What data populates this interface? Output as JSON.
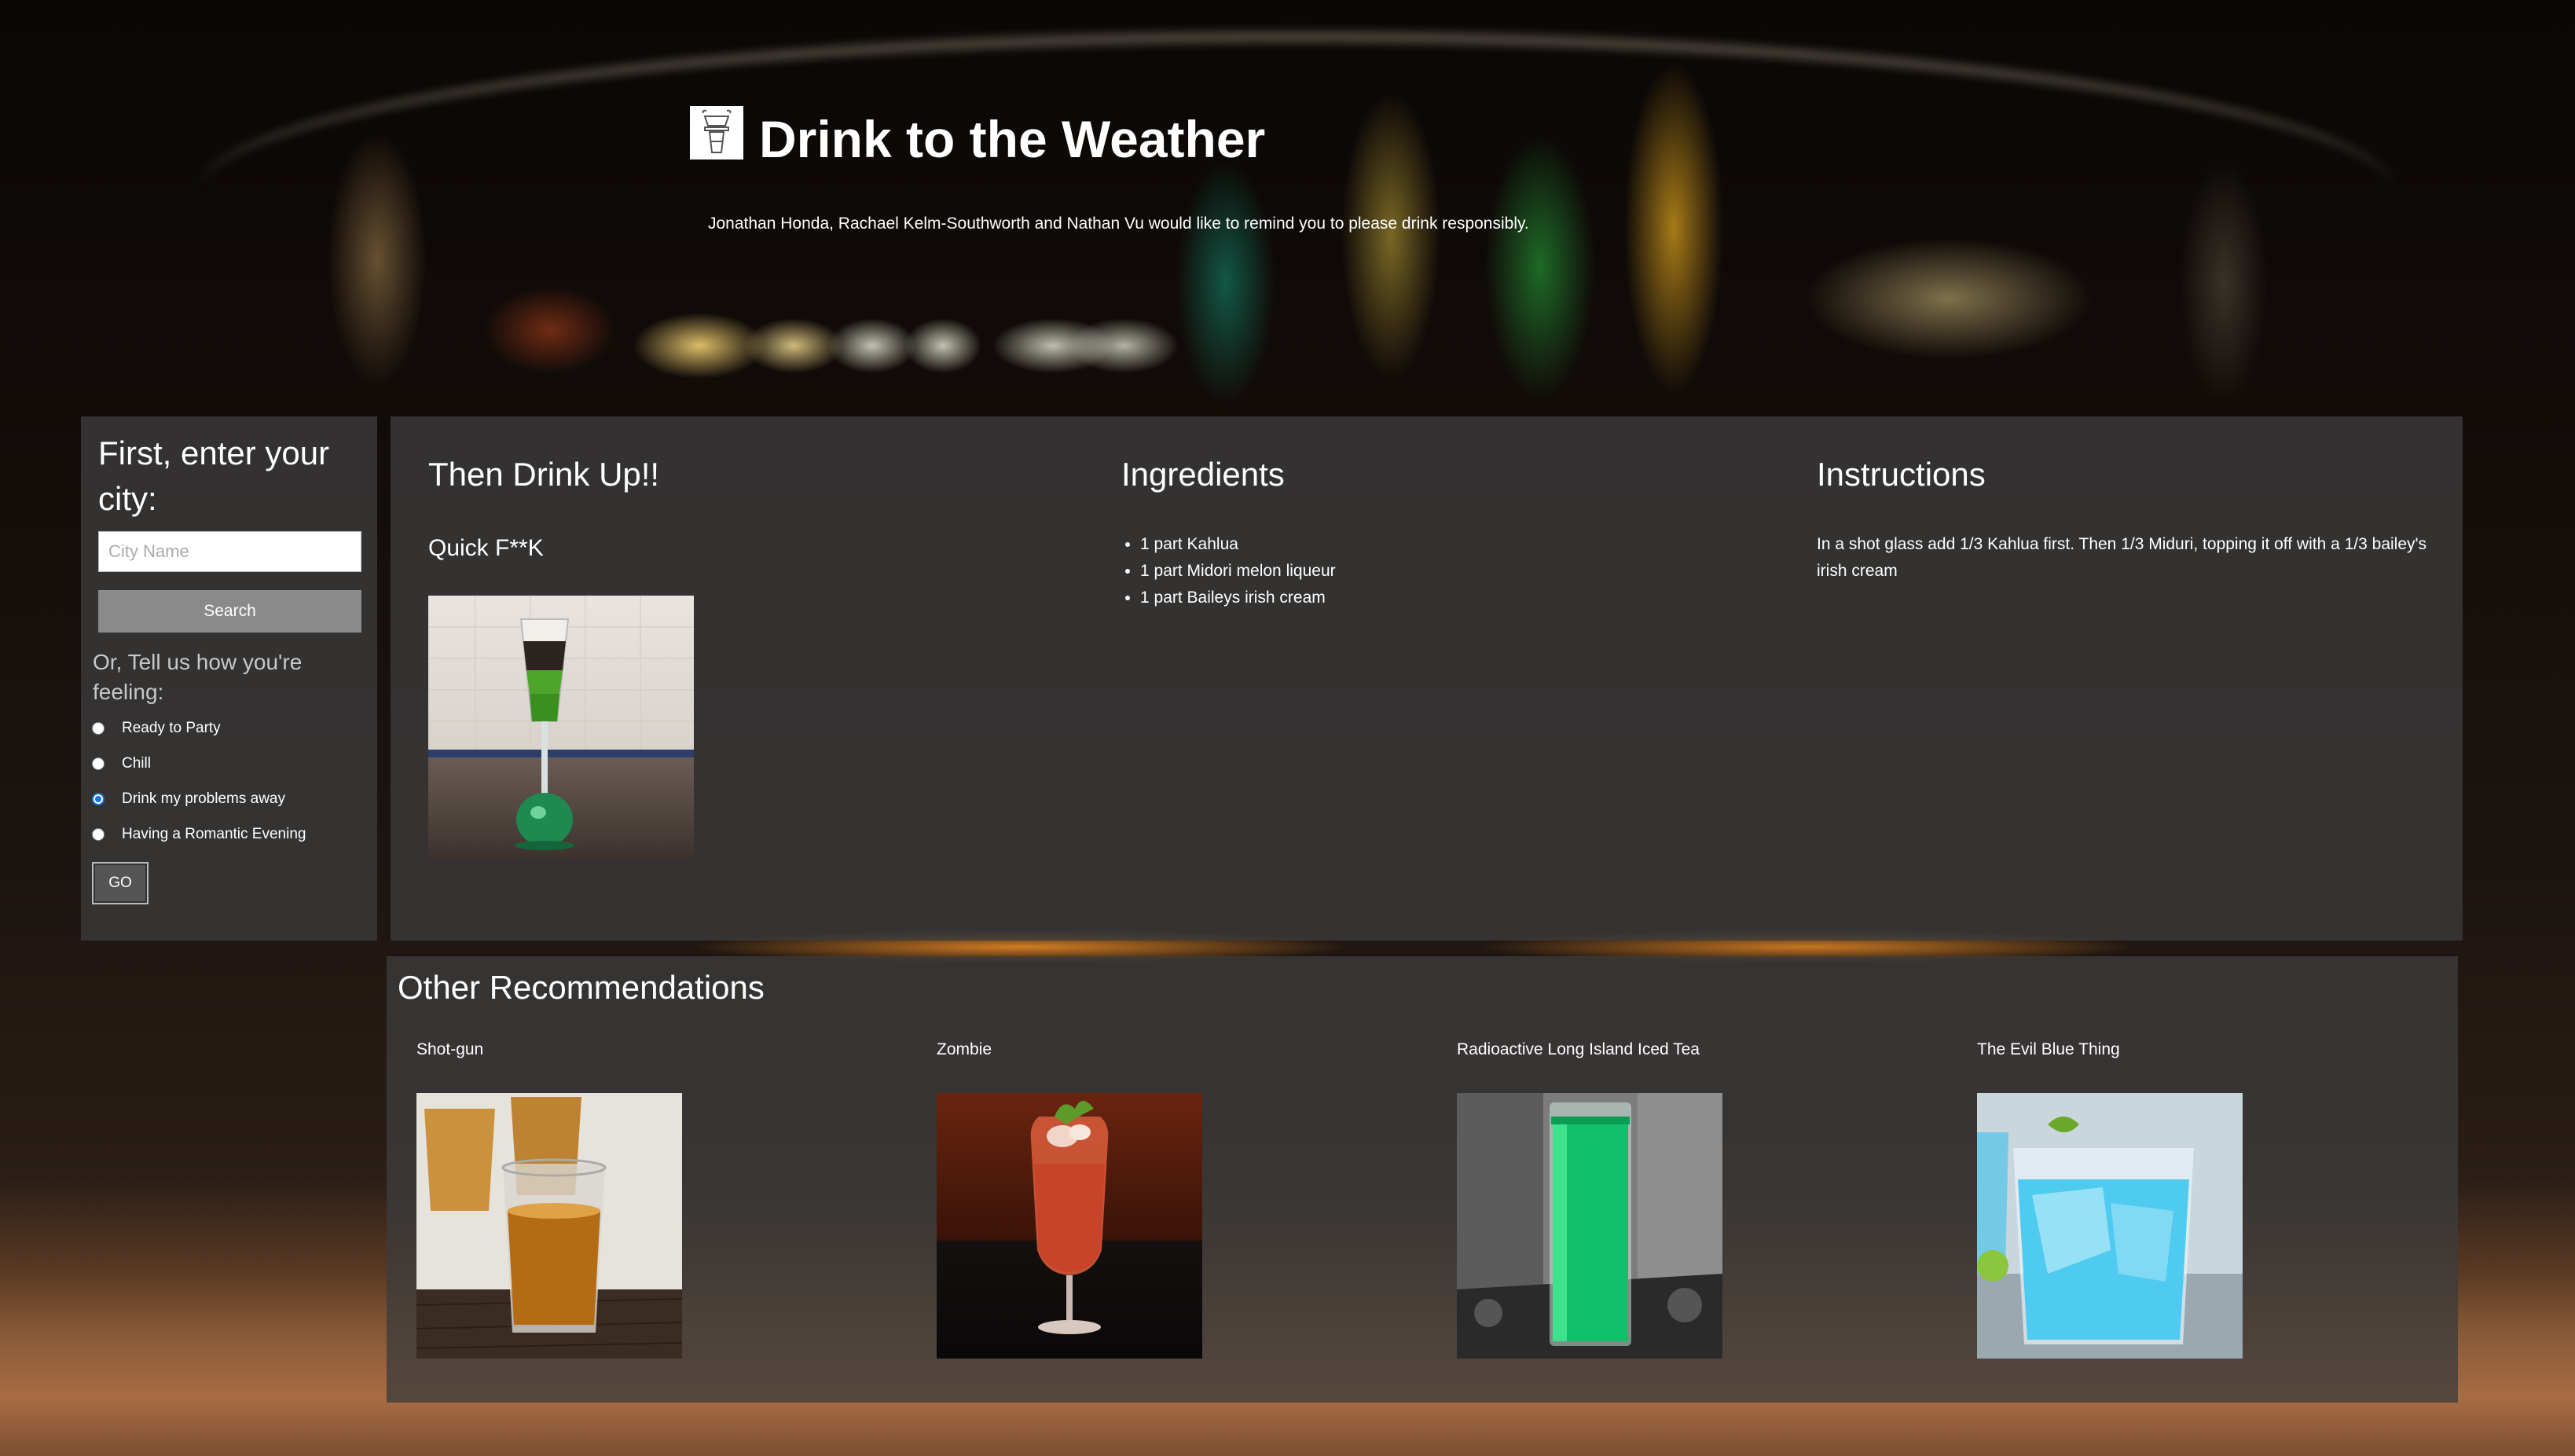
{
  "header": {
    "logo_icon": "cocktail-glass-logo",
    "title": "Drink to the Weather",
    "subtitle": "Jonathan Honda, Rachael Kelm-Southworth and Nathan Vu would like to remind you to please drink responsibly."
  },
  "sidebar": {
    "heading": "First, enter your city:",
    "city_placeholder": "City Name",
    "city_value": "",
    "search_label": "Search",
    "feeling_label": "Or, Tell us how you're feeling:",
    "moods": [
      {
        "label": "Ready to Party",
        "checked": false
      },
      {
        "label": "Chill",
        "checked": false
      },
      {
        "label": "Drink my problems away",
        "checked": true
      },
      {
        "label": "Having a Romantic Evening",
        "checked": false
      }
    ],
    "go_label": "GO"
  },
  "main": {
    "drink_heading": "Then Drink Up!!",
    "drink_name": "Quick F**K",
    "ingredients_heading": "Ingredients",
    "ingredients": [
      "1 part Kahlua",
      "1 part Midori melon liqueur",
      "1 part Baileys irish cream"
    ],
    "instructions_heading": "Instructions",
    "instructions": "In a shot glass add 1/3 Kahlua first. Then 1/3 Miduri, topping it off with a 1/3 bailey's irish cream"
  },
  "other": {
    "heading": "Other Recommendations",
    "items": [
      {
        "name": "Shot-gun"
      },
      {
        "name": "Zombie"
      },
      {
        "name": "Radioactive Long Island Iced Tea"
      },
      {
        "name": "The Evil Blue Thing"
      }
    ]
  }
}
